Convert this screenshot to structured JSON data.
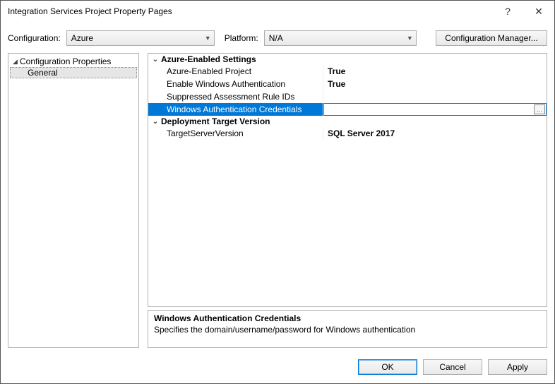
{
  "window": {
    "title": "Integration Services Project Property Pages",
    "help_icon": "?",
    "close_icon": "✕"
  },
  "configRow": {
    "configuration_label": "Configuration:",
    "configuration_value": "Azure",
    "platform_label": "Platform:",
    "platform_value": "N/A",
    "config_manager_label": "Configuration Manager..."
  },
  "tree": {
    "root_label": "Configuration Properties",
    "child_label": "General"
  },
  "propgrid": {
    "cat1_label": "Azure-Enabled Settings",
    "rows1": [
      {
        "name": "Azure-Enabled Project",
        "value": "True"
      },
      {
        "name": "Enable Windows Authentication",
        "value": "True"
      },
      {
        "name": "Suppressed Assessment Rule IDs",
        "value": ""
      },
      {
        "name": "Windows Authentication Credentials",
        "value": ""
      }
    ],
    "cat2_label": "Deployment Target Version",
    "rows2": [
      {
        "name": "TargetServerVersion",
        "value": "SQL Server 2017"
      }
    ],
    "selected_row_index": 3
  },
  "description": {
    "title": "Windows Authentication Credentials",
    "text": "Specifies the domain/username/password for Windows authentication"
  },
  "footer": {
    "ok": "OK",
    "cancel": "Cancel",
    "apply": "Apply"
  }
}
